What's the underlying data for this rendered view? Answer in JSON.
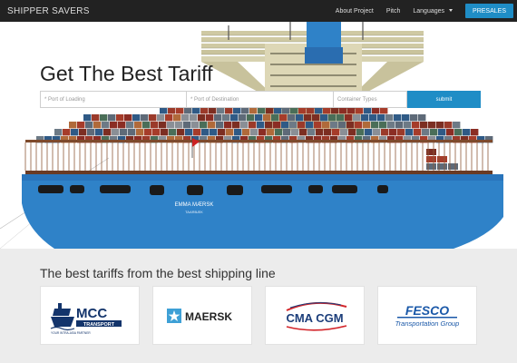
{
  "navbar": {
    "brand": "SHIPPER SAVERS",
    "links": [
      "About Project",
      "Pitch",
      "Languages"
    ],
    "presales": "PRESALES"
  },
  "hero": {
    "headline": "Get The Best Tariff",
    "ship_name": "EMMA MÆRSK",
    "ship_port": "TAARBÆK",
    "search": {
      "loading_placeholder": "* Port of Loading",
      "destination_placeholder": "* Port of Destination",
      "container_placeholder": "Container Types",
      "submit": "submit"
    }
  },
  "partners": {
    "title": "The best tariffs from the best shipping line",
    "logos": {
      "mcc": {
        "name": "MCC",
        "sub": "TRANSPORT",
        "tagline": "YOUR INTRA-ASIA PARTNER"
      },
      "maersk": {
        "name": "MAERSK"
      },
      "cma": {
        "name": "CMA CGM"
      },
      "fesco": {
        "name": "FESCO",
        "sub": "Transportation Group"
      }
    }
  },
  "colors": {
    "navbar": "#222222",
    "accent": "#1f8dc6",
    "hull": "#2f82c8",
    "cma_red": "#d3262b",
    "cma_blue": "#1b3d7a",
    "mcc_navy": "#13346b",
    "fesco_blue": "#1a58a8"
  }
}
